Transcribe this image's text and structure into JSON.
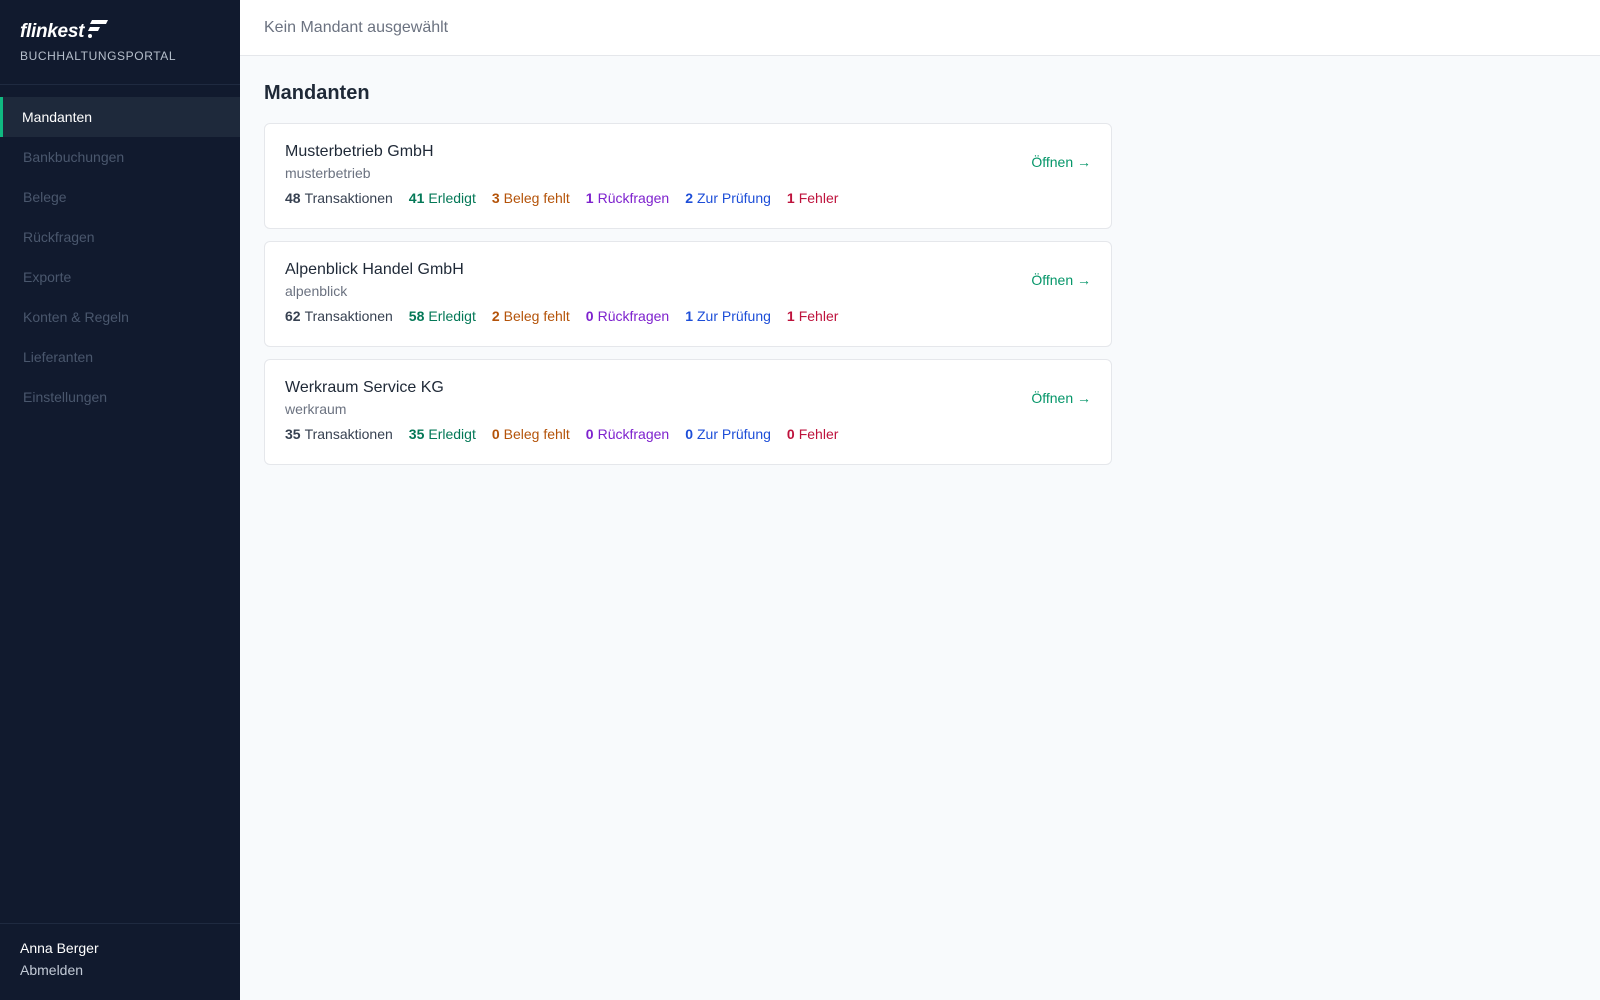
{
  "brand": {
    "name": "flinkest",
    "subtitle": "BUCHHALTUNGSPORTAL"
  },
  "nav": [
    {
      "label": "Mandanten",
      "active": true
    },
    {
      "label": "Bankbuchungen",
      "active": false
    },
    {
      "label": "Belege",
      "active": false
    },
    {
      "label": "Rückfragen",
      "active": false
    },
    {
      "label": "Exporte",
      "active": false
    },
    {
      "label": "Konten & Regeln",
      "active": false
    },
    {
      "label": "Lieferanten",
      "active": false
    },
    {
      "label": "Einstellungen",
      "active": false
    }
  ],
  "user": {
    "name": "Anna Berger",
    "logout_label": "Abmelden"
  },
  "topbar": {
    "status": "Kein Mandant ausgewählt"
  },
  "page": {
    "title": "Mandanten"
  },
  "labels": {
    "transactions": "Transaktionen",
    "done": "Erledigt",
    "missing_receipt": "Beleg fehlt",
    "queries": "Rückfragen",
    "review": "Zur Prüfung",
    "errors": "Fehler",
    "open": "Öffnen →"
  },
  "clients": [
    {
      "name": "Musterbetrieb GmbH",
      "slug": "musterbetrieb",
      "transactions": "48",
      "done": "41",
      "missing": "3",
      "queries": "1",
      "review": "2",
      "errors": "1"
    },
    {
      "name": "Alpenblick Handel GmbH",
      "slug": "alpenblick",
      "transactions": "62",
      "done": "58",
      "missing": "2",
      "queries": "0",
      "review": "1",
      "errors": "1"
    },
    {
      "name": "Werkraum Service KG",
      "slug": "werkraum",
      "transactions": "35",
      "done": "35",
      "missing": "0",
      "queries": "0",
      "review": "0",
      "errors": "0"
    }
  ],
  "colors": {
    "sidebar_bg": "#111a2e",
    "accent": "#10b981",
    "done": "#047857",
    "missing": "#b45309",
    "queries": "#7e22ce",
    "review": "#1d4ed8",
    "errors": "#be123c"
  }
}
